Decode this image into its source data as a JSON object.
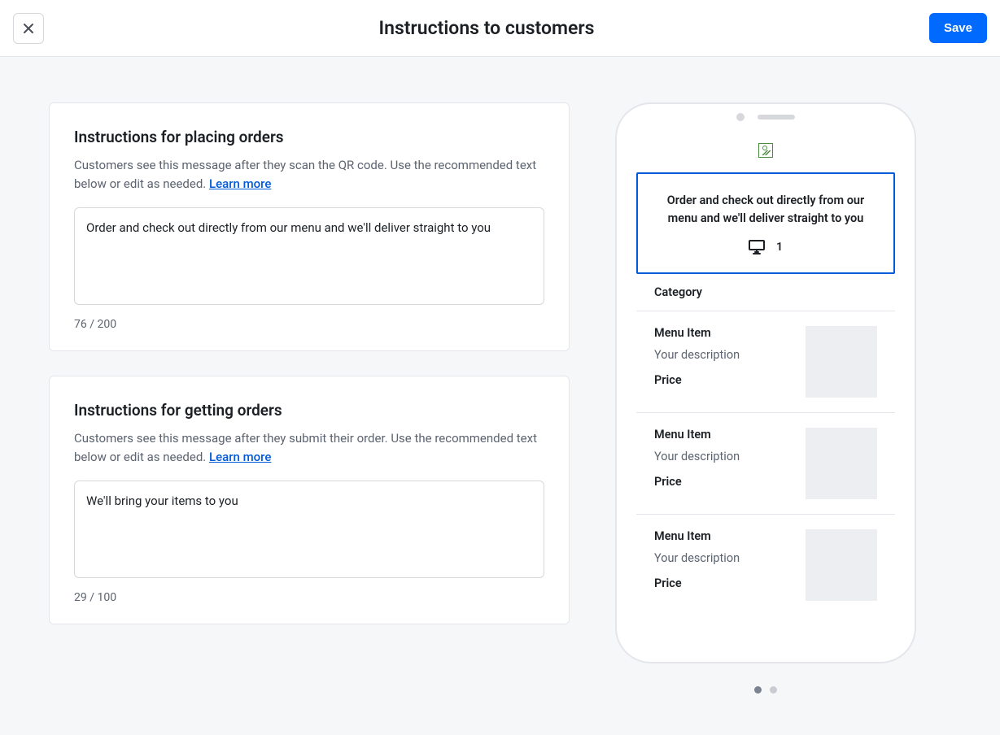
{
  "header": {
    "title": "Instructions to customers",
    "save_label": "Save"
  },
  "placing": {
    "title": "Instructions for placing orders",
    "description": "Customers see this message after they scan the QR code. Use the recommended text below or edit as needed.  ",
    "learn_more": "Learn more",
    "value": "Order and check out directly from our menu and we'll deliver straight to you",
    "char_count": "76 / 200"
  },
  "getting": {
    "title": "Instructions for getting orders",
    "description": "Customers see this message after they submit their order. Use the recommended text below or edit as needed.  ",
    "learn_more": "Learn more",
    "value": "We'll bring your items to you",
    "char_count": "29 / 100"
  },
  "preview": {
    "banner_text": "Order and check out directly from our menu and we'll deliver straight to you",
    "table_number": "1",
    "category_label": "Category",
    "items": [
      {
        "title": "Menu Item",
        "desc": "Your description",
        "price": "Price"
      },
      {
        "title": "Menu Item",
        "desc": "Your description",
        "price": "Price"
      },
      {
        "title": "Menu Item",
        "desc": "Your description",
        "price": "Price"
      }
    ]
  }
}
